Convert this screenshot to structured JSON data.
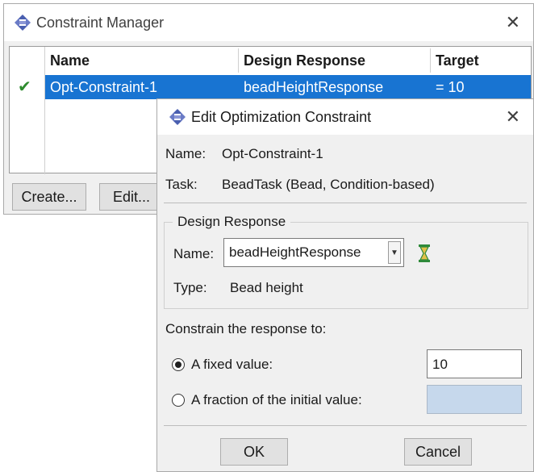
{
  "constraint_manager": {
    "title": "Constraint Manager",
    "columns": [
      "Name",
      "Design Response",
      "Target"
    ],
    "rows": [
      {
        "status": "✔",
        "name": "Opt-Constraint-1",
        "design_response": "beadHeightResponse",
        "target": "= 10"
      }
    ],
    "buttons": {
      "create": "Create...",
      "edit": "Edit..."
    }
  },
  "edit_dialog": {
    "title": "Edit Optimization Constraint",
    "name_label": "Name:",
    "name_value": "Opt-Constraint-1",
    "task_label": "Task:",
    "task_value": "BeadTask (Bead, Condition-based)",
    "design_response": {
      "group_title": "Design Response",
      "name_label": "Name:",
      "selected": "beadHeightResponse",
      "type_label": "Type:",
      "type_value": "Bead height"
    },
    "constrain_label": "Constrain the response to:",
    "options": [
      {
        "label": "A fixed value:",
        "selected": true,
        "value": "10"
      },
      {
        "label": "A fraction of the initial value:",
        "selected": false,
        "value": ""
      }
    ],
    "buttons": {
      "ok": "OK",
      "cancel": "Cancel"
    }
  },
  "colors": {
    "selection": "#1874d2",
    "disabled_field": "#c6d8ec",
    "check": "#2e8b2e"
  }
}
